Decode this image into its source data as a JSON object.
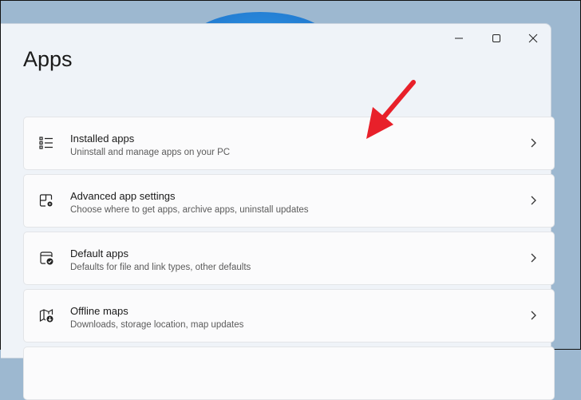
{
  "window": {
    "title": "Apps",
    "controls": {
      "minimize": "minimize-icon",
      "maximize": "maximize-icon",
      "close": "close-icon"
    }
  },
  "items": [
    {
      "title": "Installed apps",
      "subtitle": "Uninstall and manage apps on your PC",
      "icon": "list-icon"
    },
    {
      "title": "Advanced app settings",
      "subtitle": "Choose where to get apps, archive apps, uninstall updates",
      "icon": "app-settings-icon"
    },
    {
      "title": "Default apps",
      "subtitle": "Defaults for file and link types, other defaults",
      "icon": "default-apps-icon"
    },
    {
      "title": "Offline maps",
      "subtitle": "Downloads, storage location, map updates",
      "icon": "map-download-icon"
    }
  ],
  "colors": {
    "annotation": "#e8202a"
  }
}
